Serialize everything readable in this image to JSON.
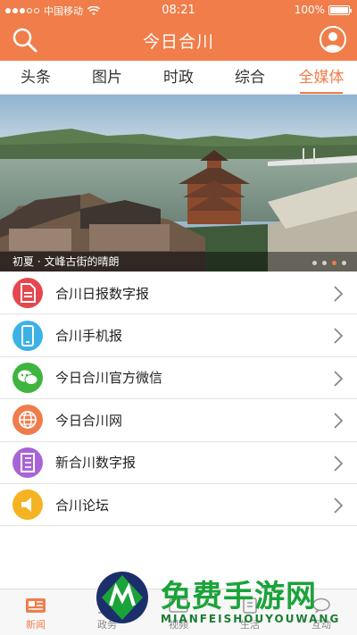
{
  "status_bar": {
    "carrier": "中国移动",
    "time": "08:21",
    "battery": "100%",
    "battery_level": 1.0
  },
  "header": {
    "title": "今日合川",
    "search_icon": "search-icon",
    "user_icon": "user-avatar-icon"
  },
  "tabs": [
    {
      "label": "头条",
      "active": false
    },
    {
      "label": "图片",
      "active": false
    },
    {
      "label": "时政",
      "active": false
    },
    {
      "label": "综合",
      "active": false
    },
    {
      "label": "全媒体",
      "active": true
    }
  ],
  "banner": {
    "caption": "初夏 · 文峰古街的晴朗",
    "slide_count": 4,
    "active_slide": 3
  },
  "list": [
    {
      "label": "合川日报数字报",
      "icon": "document-icon",
      "color": "#e5474f"
    },
    {
      "label": "合川手机报",
      "icon": "phone-icon",
      "color": "#3cb2e4"
    },
    {
      "label": "今日合川官方微信",
      "icon": "wechat-icon",
      "color": "#3fb53f"
    },
    {
      "label": "今日合川网",
      "icon": "globe-icon",
      "color": "#ef7d4c"
    },
    {
      "label": "新合川数字报",
      "icon": "newspaper-icon",
      "color": "#a864d6"
    },
    {
      "label": "合川论坛",
      "icon": "speaker-icon",
      "color": "#f5b323"
    }
  ],
  "bottom_nav": [
    {
      "label": "新闻",
      "active": true
    },
    {
      "label": "政务",
      "active": false
    },
    {
      "label": "视频",
      "active": false
    },
    {
      "label": "生活",
      "active": false
    },
    {
      "label": "互动",
      "active": false
    }
  ],
  "watermark": {
    "title": "免费手游网",
    "subtitle": "MIANFEISHOUYOUWANG"
  },
  "colors": {
    "accent": "#f07d4a"
  }
}
